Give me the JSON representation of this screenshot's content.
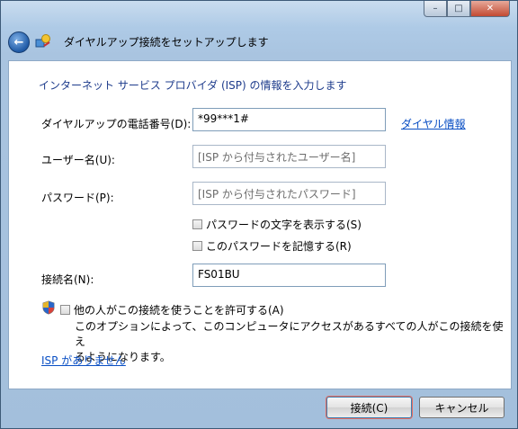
{
  "window": {
    "controls": {
      "minimize": "–",
      "maximize": "□",
      "close": "✕"
    }
  },
  "header": {
    "back_icon": "back-arrow-icon",
    "wizard_icon": "network-wizard-icon",
    "title": "ダイヤルアップ接続をセットアップします"
  },
  "form": {
    "heading": "インターネット サービス プロバイダ (ISP) の情報を入力します",
    "phone": {
      "label": "ダイヤルアップの電話番号(D):",
      "value": "*99***1#"
    },
    "dialing_rules_link": "ダイヤル情報",
    "username": {
      "label": "ユーザー名(U):",
      "placeholder": "[ISP から付与されたユーザー名]"
    },
    "password": {
      "label": "パスワード(P):",
      "placeholder": "[ISP から付与されたパスワード]"
    },
    "show_password": "パスワードの文字を表示する(S)",
    "remember_password": "このパスワードを記憶する(R)",
    "connection_name": {
      "label": "接続名(N):",
      "value": "FS01BU"
    },
    "allow_others": {
      "shield_icon": "uac-shield-icon",
      "label": "他の人がこの接続を使うことを許可する(A)",
      "description_line1": "このオプションによって、このコンピュータにアクセスがあるすべての人がこの接続を使え",
      "description_line2": "るようになります。"
    },
    "no_isp_link": "ISP がありません"
  },
  "footer": {
    "connect_button": "接続(C)",
    "cancel_button": "キャンセル"
  }
}
